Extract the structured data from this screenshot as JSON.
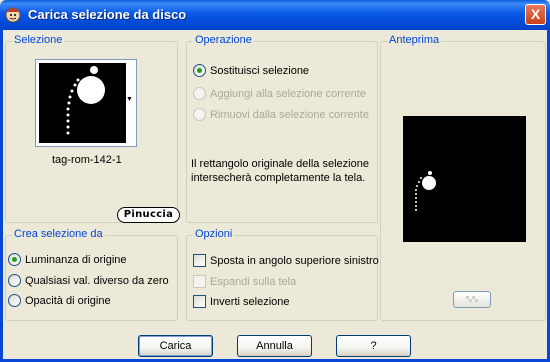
{
  "window": {
    "title": "Carica selezione da disco",
    "close_label": "X"
  },
  "selezione": {
    "label": "Selezione",
    "filename": "tag-rom-142-1"
  },
  "operazione": {
    "label": "Operazione",
    "options": [
      {
        "label": "Sostituisci selezione",
        "checked": true,
        "disabled": false
      },
      {
        "label": "Aggiungi alla selezione corrente",
        "checked": false,
        "disabled": true
      },
      {
        "label": "Rimuovi dalla selezione corrente",
        "checked": false,
        "disabled": true
      }
    ],
    "info": "Il rettangolo originale della selezione intersecherà completamente la tela."
  },
  "anteprima": {
    "label": "Anteprima"
  },
  "crea": {
    "label": "Crea selezione da",
    "options": [
      {
        "label": "Luminanza di origine",
        "checked": true
      },
      {
        "label": "Qualsiasi val. diverso da zero",
        "checked": false
      },
      {
        "label": "Opacità di origine",
        "checked": false
      }
    ]
  },
  "opzioni": {
    "label": "Opzioni",
    "items": [
      {
        "label": "Sposta in angolo superiore sinistro",
        "checked": false,
        "disabled": false
      },
      {
        "label": "Espandi sulla tela",
        "checked": false,
        "disabled": true
      },
      {
        "label": "Inverti selezione",
        "checked": false,
        "disabled": false
      }
    ]
  },
  "logo": {
    "text": "Pinuccia"
  },
  "buttons": {
    "load": "Carica",
    "cancel": "Annulla",
    "help": "?"
  }
}
